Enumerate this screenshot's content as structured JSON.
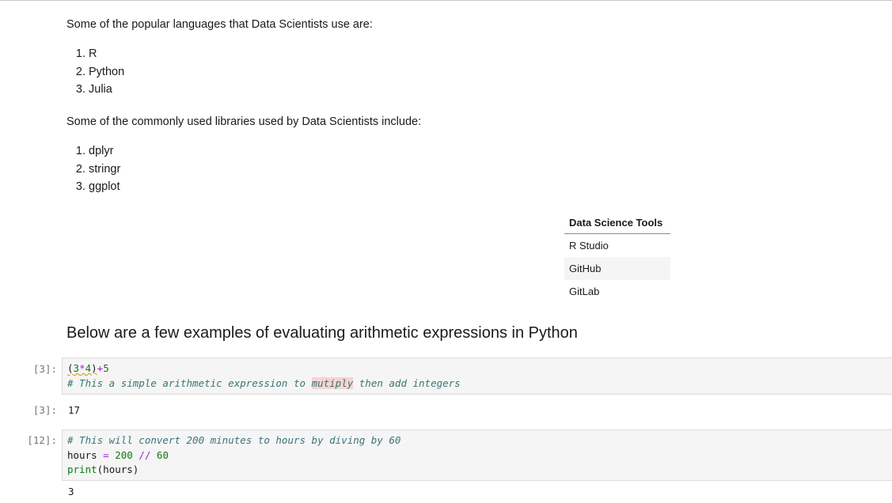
{
  "notebook": {
    "languages_intro": "Some of the popular languages that Data Scientists use are:",
    "languages": [
      "R",
      "Python",
      "Julia"
    ],
    "libraries_intro": "Some of the commonly used libraries used by Data Scientists include:",
    "libraries": [
      "dplyr",
      "stringr",
      "ggplot"
    ],
    "tools_table": {
      "header": "Data Science Tools",
      "rows": [
        "R Studio",
        "GitHub",
        "GitLab"
      ]
    },
    "arithmetic_heading": "Below are a few examples of evaluating arithmetic expressions in Python",
    "cells": [
      {
        "input_prompt": "[3]:",
        "code_line1": {
          "open": "(",
          "a": "3",
          "mul": "*",
          "b": "4",
          "close": ")",
          "plus": "+",
          "c": "5"
        },
        "code_line2": {
          "before": "# This a simple arithmetic expression to ",
          "misspelled": "mutiply",
          "after": " then add integers"
        },
        "output_prompt": "[3]:",
        "output": "17"
      },
      {
        "input_prompt": "[12]:",
        "code_line1": "# This will convert 200 minutes to hours by diving by 60",
        "code_line2": {
          "var": "hours ",
          "eq": "=",
          "sp1": " ",
          "num1": "200",
          "sp2": " ",
          "op": "//",
          "sp3": " ",
          "num2": "60"
        },
        "code_line3": {
          "fn": "print",
          "args": "(hours)"
        },
        "output": "3"
      }
    ]
  }
}
